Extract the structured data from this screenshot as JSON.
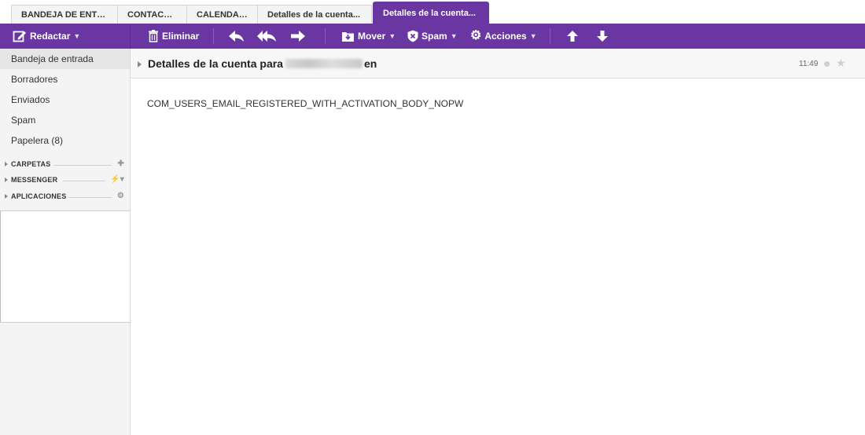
{
  "tabs": [
    {
      "label": "BANDEJA DE ENTRADA"
    },
    {
      "label": "CONTACTOS"
    },
    {
      "label": "CALENDARIO"
    },
    {
      "label": "Detalles de la cuenta..."
    },
    {
      "label": "Detalles de la cuenta..."
    }
  ],
  "toolbar": {
    "compose_label": "Redactar",
    "delete_label": "Eliminar",
    "move_label": "Mover",
    "spam_label": "Spam",
    "actions_label": "Acciones"
  },
  "sidebar": {
    "folders": [
      {
        "label": "Bandeja de entrada"
      },
      {
        "label": "Borradores"
      },
      {
        "label": "Enviados"
      },
      {
        "label": "Spam"
      },
      {
        "label": "Papelera (8)"
      }
    ],
    "sections": [
      {
        "label": "CARPETAS",
        "icon": "plus-icon"
      },
      {
        "label": "MESSENGER",
        "icon": "status-icon"
      },
      {
        "label": "APLICACIONES",
        "icon": "gear-icon"
      }
    ]
  },
  "message": {
    "subject_prefix": "Detalles de la cuenta para",
    "subject_suffix": "en",
    "time": "11:49",
    "body": "COM_USERS_EMAIL_REGISTERED_WITH_ACTIVATION_BODY_NOPW"
  },
  "colors": {
    "accent": "#6a36a1",
    "sidebar_bg": "#f4f4f4"
  }
}
